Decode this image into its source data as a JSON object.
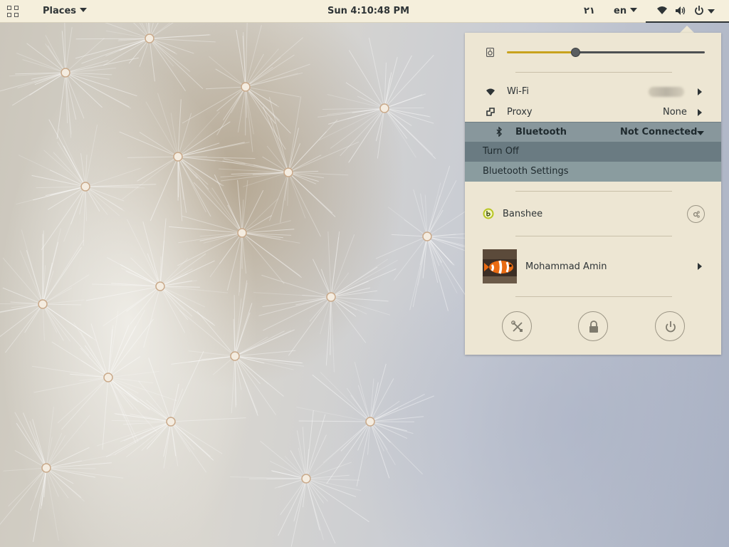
{
  "topbar": {
    "places_label": "Places",
    "clock": "Sun  4:10:48 PM",
    "indicator_digits": "۲۱",
    "language": "en"
  },
  "menu": {
    "volume_level": 0.35,
    "wifi_label": "Wi-Fi",
    "proxy_label": "Proxy",
    "proxy_value": "None",
    "bluetooth_label": "Bluetooth",
    "bluetooth_status": "Not Connected",
    "bluetooth_turn_off": "Turn Off",
    "bluetooth_settings": "Bluetooth Settings",
    "player_name": "Banshee",
    "user_name": "Mohammad Amin"
  },
  "colors": {
    "panel_bg": "#f5efdc",
    "menu_bg": "#ede6d3",
    "slider_fill": "#c8a21c",
    "bluetooth_header": "#88979c",
    "bluetooth_item_hover": "#6a7b82",
    "banshee_icon": "#b7c520"
  },
  "icons": [
    "activities-icon",
    "network-wireless-icon",
    "volume-icon",
    "power-icon",
    "speaker-icon",
    "wifi-icon",
    "proxy-icon",
    "bluetooth-icon",
    "banshee-icon",
    "settings-icon",
    "lock-icon",
    "power-off-icon"
  ]
}
